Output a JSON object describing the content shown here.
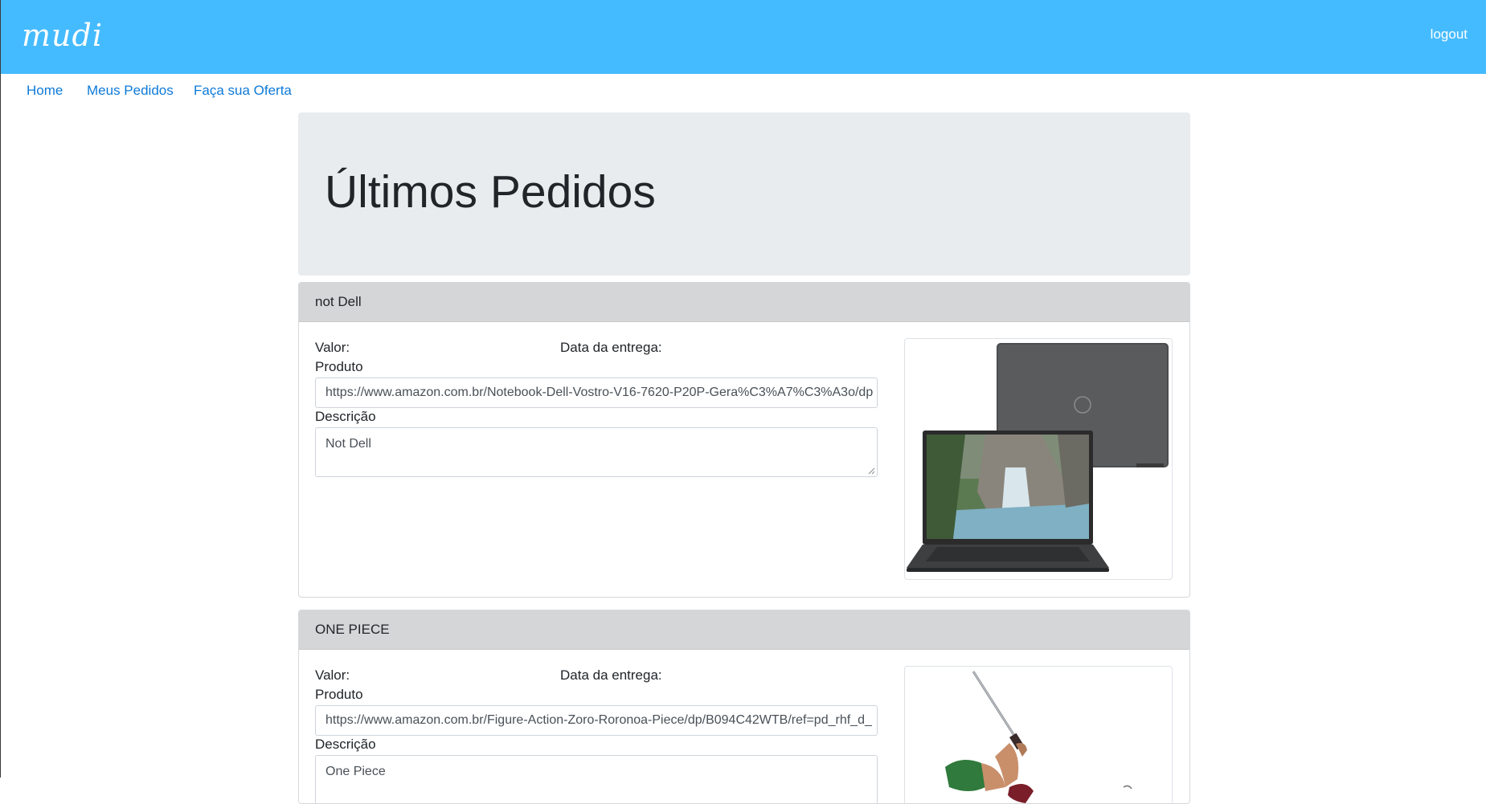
{
  "brand": "mudi",
  "header": {
    "logout_label": "logout"
  },
  "nav": {
    "home": "Home",
    "my_orders": "Meus Pedidos",
    "make_offer": "Faça sua Oferta"
  },
  "page_title": "Últimos Pedidos",
  "orders": [
    {
      "title": "not Dell",
      "valor_label": "Valor:",
      "valor": "",
      "entrega_label": "Data da entrega:",
      "entrega": "",
      "produto_label": "Produto",
      "produto_url": "https://www.amazon.com.br/Notebook-Dell-Vostro-V16-7620-P20P-Gera%C3%A7%C3%A3o/dp",
      "descricao_label": "Descrição",
      "descricao": "Not Dell",
      "image_icon": "laptop-image"
    },
    {
      "title": "ONE PIECE",
      "valor_label": "Valor:",
      "valor": "",
      "entrega_label": "Data da entrega:",
      "entrega": "",
      "produto_label": "Produto",
      "produto_url": "https://www.amazon.com.br/Figure-Action-Zoro-Roronoa-Piece/dp/B094C42WTB/ref=pd_rhf_d_",
      "descricao_label": "Descrição",
      "descricao": "One Piece",
      "image_icon": "figure-image"
    }
  ],
  "colors": {
    "topbar": "#45bbff",
    "link": "#0d7ad8",
    "jumbotron": "#e9ecef",
    "card_header": "#d5d6d8"
  }
}
